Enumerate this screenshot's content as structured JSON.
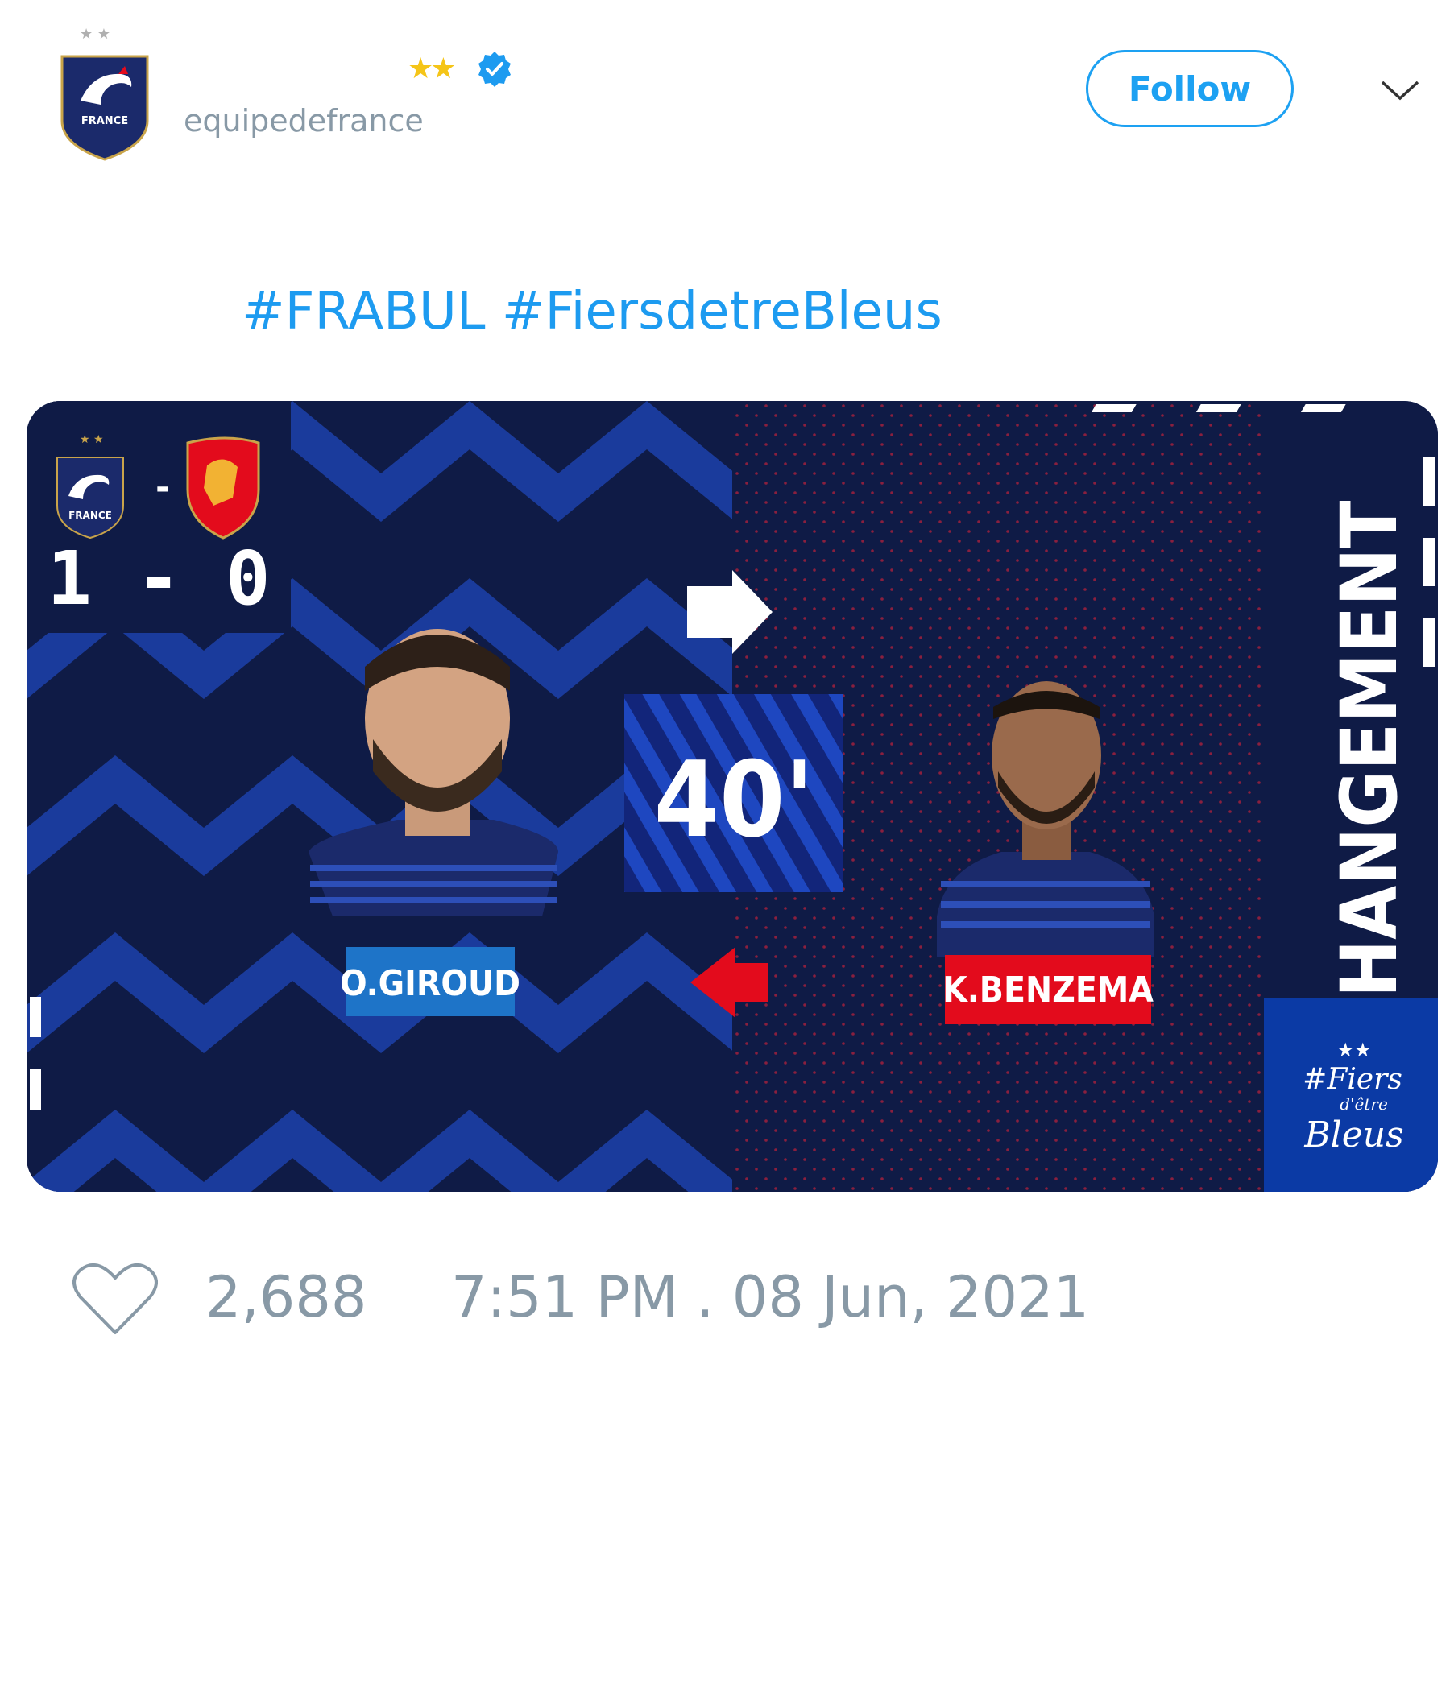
{
  "account": {
    "display_name": "",
    "handle": "equipedefrance",
    "avatar_icon": "fff-crest-logo",
    "avatar_badge_text": "FRANCE",
    "name_stars": "★★",
    "verified_icon": "verified-badge-icon"
  },
  "follow_button": {
    "label": "Follow"
  },
  "menu_icon": "chevron-down-icon",
  "tweet": {
    "hashtags": [
      "#FRABUL",
      "#FiersdetreBleus"
    ]
  },
  "graphic": {
    "scoreline": "1 - 0",
    "team_home_crest": "france-crest",
    "team_home_label": "FRANCE",
    "team_away_crest": "bulgaria-crest",
    "minute": "40'",
    "player_out": "O.GIROUD",
    "player_in": "K.BENZEMA",
    "headline": "CHANGEMENT",
    "brand_stars": "★★",
    "brand_logo_text": [
      "#Fiers",
      "d'être",
      "Bleus"
    ],
    "colors": {
      "navy": "#0f1b46",
      "blue": "#1a3b9c",
      "out_label": "#1e74c8",
      "in_label": "#e30b1c",
      "brand_panel": "#0b3aa5"
    }
  },
  "footer": {
    "like_icon": "heart-outline-icon",
    "likes": "2,688",
    "timestamp": "7:51 PM . 08 Jun, 2021"
  }
}
